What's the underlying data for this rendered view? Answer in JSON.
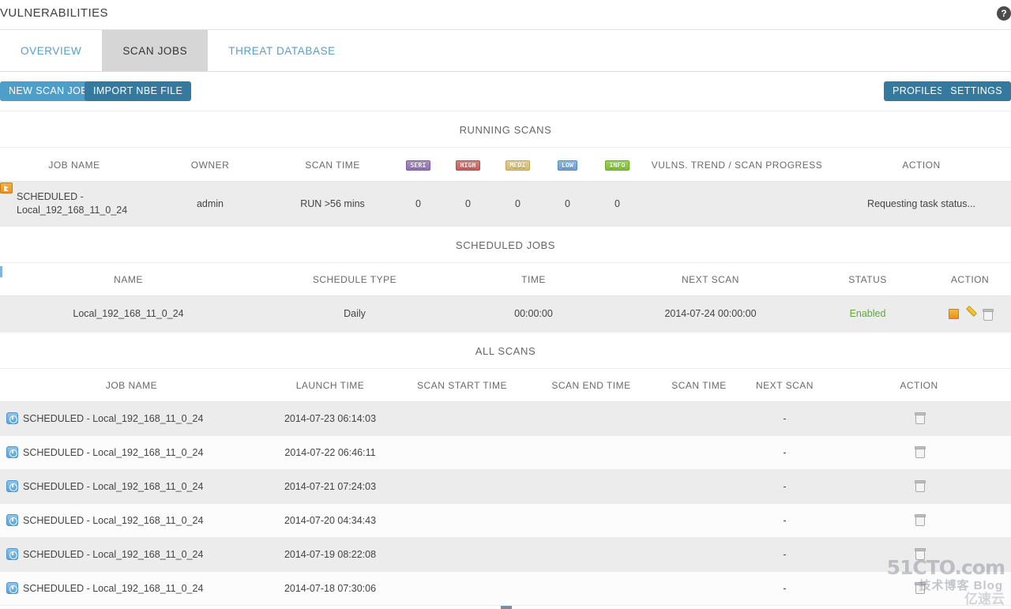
{
  "header": {
    "title": "VULNERABILITIES",
    "help_icon": "question-mark-icon",
    "help_label": "?"
  },
  "tabs": [
    {
      "label": "OVERVIEW",
      "active": false
    },
    {
      "label": "SCAN JOBS",
      "active": true
    },
    {
      "label": "THREAT DATABASE",
      "active": false
    }
  ],
  "toolbar": {
    "new_scan_job": "NEW SCAN JOB",
    "import_nbe_file": "IMPORT NBE FILE",
    "profiles": "PROFILES",
    "settings": "SETTINGS",
    "new_scan_job_color": "#4d9fc9",
    "import_nbe_file_color": "#357a9e",
    "profiles_color": "#357a9e",
    "settings_color": "#357a9e"
  },
  "running_scans": {
    "title": "RUNNING SCANS",
    "columns": {
      "job_name": "JOB NAME",
      "owner": "OWNER",
      "scan_time": "SCAN TIME",
      "severity": [
        {
          "label": "SERI",
          "name": "severity-serious",
          "color": "#8f6fb4"
        },
        {
          "label": "HIGH",
          "name": "severity-high",
          "color": "#c85a5a"
        },
        {
          "label": "MEDI",
          "name": "severity-medium",
          "color": "#d3bd6a"
        },
        {
          "label": "LOW",
          "name": "severity-low",
          "color": "#6b9fd4"
        },
        {
          "label": "INFO",
          "name": "severity-info",
          "color": "#7ec02f"
        }
      ],
      "vulns_trend": "VULNS. TREND / SCAN PROGRESS",
      "action": "ACTION"
    },
    "rows": [
      {
        "icon": "running-scan-icon",
        "job_name_line1": "SCHEDULED -",
        "job_name_line2": "Local_192_168_11_0_24",
        "owner": "admin",
        "scan_time": "RUN >56 mins",
        "seri": "0",
        "high": "0",
        "medi": "0",
        "low": "0",
        "info": "0",
        "trend": "",
        "action": "Requesting task status..."
      }
    ]
  },
  "scheduled_jobs": {
    "title": "SCHEDULED JOBS",
    "columns": {
      "name": "NAME",
      "schedule_type": "SCHEDULE TYPE",
      "time": "TIME",
      "next_scan": "NEXT SCAN",
      "status": "STATUS",
      "action": "ACTION"
    },
    "rows": [
      {
        "name": "Local_192_168_11_0_24",
        "schedule_type": "Daily",
        "time": "00:00:00",
        "next_scan": "2014-07-24 00:00:00",
        "status": "Enabled",
        "status_color": "#5fa83c",
        "actions": [
          "stop-icon",
          "edit-pencil-icon",
          "trash-icon"
        ]
      }
    ]
  },
  "all_scans": {
    "title": "ALL SCANS",
    "columns": {
      "job_name": "JOB NAME",
      "launch_time": "LAUNCH TIME",
      "scan_start_time": "SCAN START TIME",
      "scan_end_time": "SCAN END TIME",
      "scan_time": "SCAN TIME",
      "next_scan": "NEXT SCAN",
      "action": "ACTION"
    },
    "rows": [
      {
        "icon": "clock-icon",
        "job_name": "SCHEDULED - Local_192_168_11_0_24",
        "launch_time": "2014-07-23 06:14:03",
        "scan_start_time": "",
        "scan_end_time": "",
        "scan_time": "",
        "next_scan": "-",
        "action": "trash-icon"
      },
      {
        "icon": "clock-icon",
        "job_name": "SCHEDULED - Local_192_168_11_0_24",
        "launch_time": "2014-07-22 06:46:11",
        "scan_start_time": "",
        "scan_end_time": "",
        "scan_time": "",
        "next_scan": "-",
        "action": "trash-icon"
      },
      {
        "icon": "clock-icon",
        "job_name": "SCHEDULED - Local_192_168_11_0_24",
        "launch_time": "2014-07-21 07:24:03",
        "scan_start_time": "",
        "scan_end_time": "",
        "scan_time": "",
        "next_scan": "-",
        "action": "trash-icon"
      },
      {
        "icon": "clock-icon",
        "job_name": "SCHEDULED - Local_192_168_11_0_24",
        "launch_time": "2014-07-20 04:34:43",
        "scan_start_time": "",
        "scan_end_time": "",
        "scan_time": "",
        "next_scan": "-",
        "action": "trash-icon"
      },
      {
        "icon": "clock-icon",
        "job_name": "SCHEDULED - Local_192_168_11_0_24",
        "launch_time": "2014-07-19 08:22:08",
        "scan_start_time": "",
        "scan_end_time": "",
        "scan_time": "",
        "next_scan": "-",
        "action": "trash-icon"
      },
      {
        "icon": "clock-icon",
        "job_name": "SCHEDULED - Local_192_168_11_0_24",
        "launch_time": "2014-07-18 07:30:06",
        "scan_start_time": "",
        "scan_end_time": "",
        "scan_time": "",
        "next_scan": "-",
        "action": "trash-icon"
      }
    ]
  },
  "watermarks": {
    "primary": "51CTO.com",
    "primary_sub": "技术博客  Blog",
    "secondary": "亿速云"
  }
}
